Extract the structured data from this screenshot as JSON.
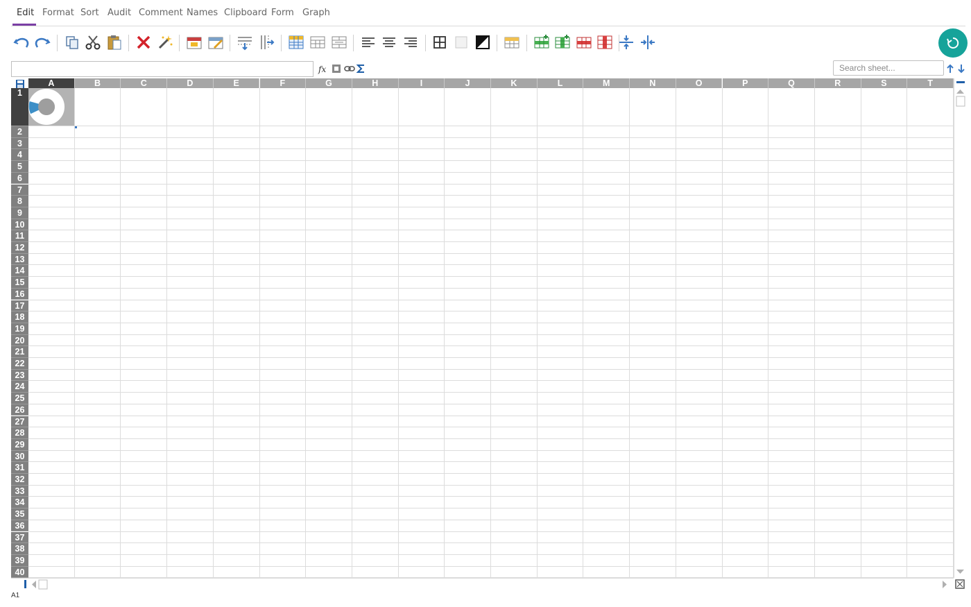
{
  "menu": [
    {
      "label": "Edit",
      "active": true
    },
    {
      "label": "Format"
    },
    {
      "label": "Sort"
    },
    {
      "label": "Audit"
    },
    {
      "label": "Comment"
    },
    {
      "label": "Names"
    },
    {
      "label": "Clipboard"
    },
    {
      "label": "Form"
    },
    {
      "label": "Graph"
    }
  ],
  "toolbar": {
    "icons": [
      "undo-icon",
      "redo-icon",
      "copy-icon",
      "cut-icon",
      "paste-icon",
      "delete-icon",
      "magic-wand-icon",
      "insert-cells-icon",
      "edit-cells-icon",
      "insert-row-icon",
      "insert-column-icon",
      "table-format-icon",
      "merge-cells-icon",
      "unmerge-cells-icon",
      "align-left-icon",
      "align-center-icon",
      "align-right-icon",
      "borders-all-icon",
      "borders-none-icon",
      "fill-color-icon",
      "sort-rows-icon",
      "insert-row-above-icon",
      "insert-column-left-icon",
      "delete-row-icon",
      "delete-column-icon",
      "freeze-rows-icon",
      "freeze-columns-icon"
    ]
  },
  "formula": {
    "value": "",
    "icons": [
      "function-icon",
      "cell-reference-icon",
      "link-icon",
      "sum-icon"
    ]
  },
  "search": {
    "placeholder": "Search sheet...",
    "icons": [
      "search-up-icon",
      "search-down-icon"
    ]
  },
  "sheet": {
    "columns": [
      "A",
      "B",
      "C",
      "D",
      "E",
      "F",
      "G",
      "H",
      "I",
      "J",
      "K",
      "L",
      "M",
      "N",
      "O",
      "P",
      "Q",
      "R",
      "S",
      "T"
    ],
    "rows": [
      1,
      2,
      3,
      4,
      5,
      6,
      7,
      8,
      9,
      10,
      11,
      12,
      13,
      14,
      15,
      16,
      17,
      18,
      19,
      20,
      21,
      22,
      23,
      24,
      25,
      26,
      27,
      28,
      29,
      30,
      31,
      32,
      33,
      34,
      35,
      36,
      37,
      38,
      39,
      40
    ],
    "selected_column": "A",
    "selected_row": 1,
    "embedded_chart": {
      "type": "donut",
      "colors": {
        "highlight": "#3d8fc7",
        "ring": "#ffffff",
        "center": "#9e9e9e"
      }
    }
  },
  "status": {
    "cell_ref": "A1"
  },
  "colors": {
    "accent": "#7b3fa5",
    "refresh": "#16a39a",
    "header_gray": "#a6a6a6",
    "header_selected": "#404040"
  }
}
